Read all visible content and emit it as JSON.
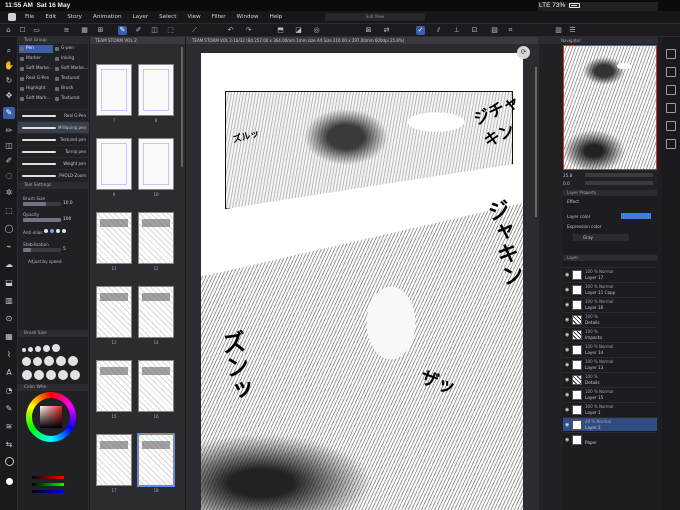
{
  "status": {
    "time": "11:55 AM",
    "date": "Sat 16 May",
    "network": "LTE",
    "battery": "73%"
  },
  "menu": {
    "items": [
      "File",
      "Edit",
      "Story",
      "Animation",
      "Layer",
      "Select",
      "View",
      "Filter",
      "Window",
      "Help"
    ],
    "center_tab": "Sub View"
  },
  "subtool": {
    "header": "Tool Group",
    "items": [
      "Pen",
      "G-pen",
      "Marker",
      "Inking",
      "Soft Marke...",
      "Soft Marke...",
      "Real G-Pen",
      "Textured",
      "Highlight",
      "Brush",
      "Soft Mark...",
      "Textured"
    ],
    "brushes": [
      "Real G-Pen",
      "Milliquing pen",
      "Textured pen",
      "Turnip pen",
      "Weight pen",
      "PHOLD-Zoom"
    ]
  },
  "toolprop": {
    "header": "Tool Settings",
    "brush_size_label": "Brush Size",
    "brush_size": "10.0",
    "brush_size_level": 0.6,
    "opacity_label": "Opacity",
    "opacity": "100",
    "opacity_level": 1.0,
    "antialias_label": "Anti-alias",
    "stabilization_label": "Stabilization",
    "stabilization": "5",
    "stabilization_level": 0.2,
    "adjust_label": "Adjust by speed"
  },
  "color": {
    "brush_size_label": "Brush Size",
    "wheel_label": "Color Whe",
    "main_color": "#111111"
  },
  "pages": {
    "tab": "TEAM STORM VOL 2",
    "numbers": [
      "7",
      "8",
      "9",
      "10",
      "11",
      "12",
      "13",
      "14",
      "15",
      "16",
      "17",
      "18"
    ]
  },
  "canvas": {
    "tab": "TEAM STORM VOL 2-16/32 (B4 257.00 x 364.00mm 1mm size A4 Size 210.00 x 297.00mm 600dpi 25.8%)",
    "sfx": [
      "ジチャキン",
      "ズルッ",
      "ジャキン",
      "ズンッ",
      "ザッ"
    ]
  },
  "navigator": {
    "tab": "Navigator",
    "zoom": "25.8",
    "angle": "0.0"
  },
  "layer_property": {
    "header": "Layer Property",
    "effect_label": "Effect",
    "layer_color_label": "Layer color",
    "expression_label": "Expression color",
    "expression_value": "Gray"
  },
  "layers": {
    "header": "Layer",
    "items": [
      {
        "mode": "100 % Normal",
        "name": "Layer 17",
        "dark": false
      },
      {
        "mode": "100 % Normal",
        "name": "Layer 11 Copy",
        "dark": false
      },
      {
        "mode": "100 % Normal",
        "name": "Layer 16",
        "dark": false
      },
      {
        "mode": "100 %",
        "name": "Details",
        "dark": true
      },
      {
        "mode": "100 %",
        "name": "Impacto",
        "dark": true
      },
      {
        "mode": "100 % Normal",
        "name": "Layer 14",
        "dark": false
      },
      {
        "mode": "100 % Normal",
        "name": "Layer 13",
        "dark": false
      },
      {
        "mode": "100 %",
        "name": "Details",
        "dark": true
      },
      {
        "mode": "100 % Normal",
        "name": "Layer 15",
        "dark": false
      },
      {
        "mode": "100 % Normal",
        "name": "Layer 1",
        "dark": false
      },
      {
        "mode": "48 % Normal",
        "name": "Layer 2",
        "dark": false
      },
      {
        "mode": "",
        "name": "Paper",
        "dark": false
      }
    ],
    "selected_index": 10
  }
}
